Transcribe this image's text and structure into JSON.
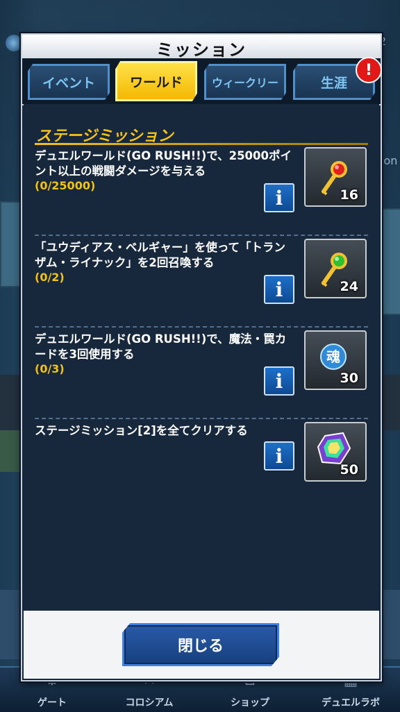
{
  "window": {
    "title": "ミッション"
  },
  "tabs": [
    {
      "label": "イベント"
    },
    {
      "label": "ワールド"
    },
    {
      "label": "ウィークリー"
    },
    {
      "label": "生涯"
    }
  ],
  "badge": {
    "text": "!"
  },
  "section": {
    "heading": "ステージミッション"
  },
  "missions": [
    {
      "text": "デュエルワールド(GO RUSH!!)で、25000ポイント以上の戦闘ダメージを与える",
      "progress": "(0/25000)",
      "reward_icon": "red-gem-key-icon",
      "reward_count": "16"
    },
    {
      "text": "「ユウディアス・ベルギャー」を使って「トランザム・ライナック」を2回召喚する",
      "progress": "(0/2)",
      "reward_icon": "green-gem-key-icon",
      "reward_count": "24"
    },
    {
      "text": "デュエルワールド(GO RUSH!!)で、魔法・罠カードを3回使用する",
      "progress": "(0/3)",
      "reward_icon": "blue-orb-icon",
      "reward_count": "30"
    },
    {
      "text": "ステージミッション[2]を全てクリアする",
      "progress": "",
      "reward_icon": "rainbow-gem-icon",
      "reward_count": "50"
    }
  ],
  "info_label": "i",
  "close_button": {
    "label": "閉じる"
  },
  "orb_glyph": "魂",
  "bottom_nav": [
    {
      "label": "ゲート"
    },
    {
      "label": "コロシアム"
    },
    {
      "label": "ショップ"
    },
    {
      "label": "デュエルラボ"
    }
  ],
  "background": {
    "top_right_number": "2",
    "side_text": "ion"
  },
  "colors": {
    "accent_gold": "#f4c21a",
    "tab_blue": "#7fc6f5",
    "button_blue": "#16407e"
  }
}
